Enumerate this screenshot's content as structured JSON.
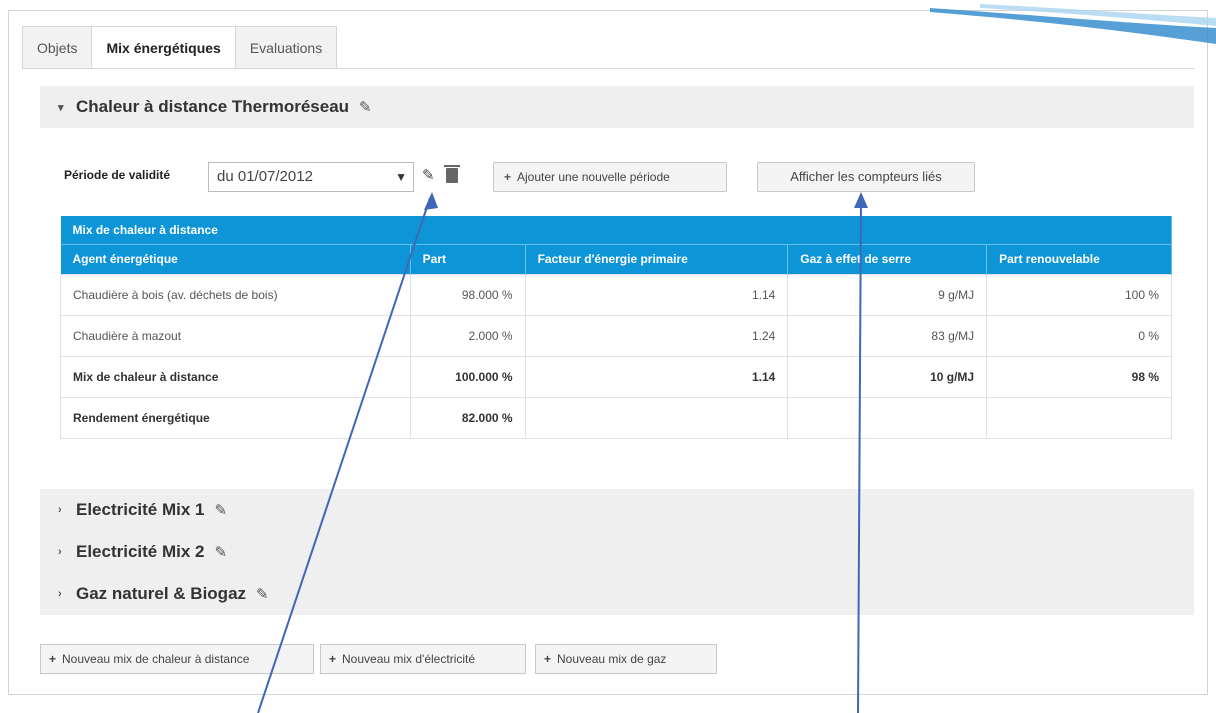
{
  "tabs": [
    {
      "label": "Objets"
    },
    {
      "label": "Mix énergétiques"
    },
    {
      "label": "Evaluations"
    }
  ],
  "open_mix": {
    "title": "Chaleur à distance Thermoréseau",
    "period_label": "Période de validité",
    "period_value": "du 01/07/2012",
    "add_period_label": "Ajouter une nouvelle période",
    "show_meters_label": "Afficher les compteurs liés",
    "table": {
      "caption": "Mix de chaleur à distance",
      "columns": [
        "Agent énergétique",
        "Part",
        "Facteur d'énergie primaire",
        "Gaz à effet de serre",
        "Part renouvelable"
      ],
      "rows": [
        [
          "Chaudière à bois (av. déchets de bois)",
          "98.000 %",
          "1.14",
          "9 g/MJ",
          "100 %"
        ],
        [
          "Chaudière à mazout",
          "2.000 %",
          "1.24",
          "83 g/MJ",
          "0 %"
        ],
        [
          "Mix de chaleur à distance",
          "100.000 %",
          "1.14",
          "10 g/MJ",
          "98 %"
        ],
        [
          "Rendement énergétique",
          "82.000 %",
          "",
          "",
          ""
        ]
      ]
    }
  },
  "collapsed_mixes": [
    {
      "title": "Electricité Mix 1"
    },
    {
      "title": "Electricité Mix 2"
    },
    {
      "title": "Gaz naturel & Biogaz"
    }
  ],
  "add_buttons": [
    {
      "label": "Nouveau mix de chaleur à distance"
    },
    {
      "label": "Nouveau mix d'électricité"
    },
    {
      "label": "Nouveau mix de gaz"
    }
  ],
  "icons": {
    "expanded_caret": "caret-down-icon",
    "collapsed_caret": "caret-right-icon",
    "edit": "pencil-icon",
    "delete": "trash-icon",
    "add": "plus-icon"
  },
  "colors": {
    "table_header": "#0e95d8",
    "annotation_arrow": "#3f67b8"
  }
}
